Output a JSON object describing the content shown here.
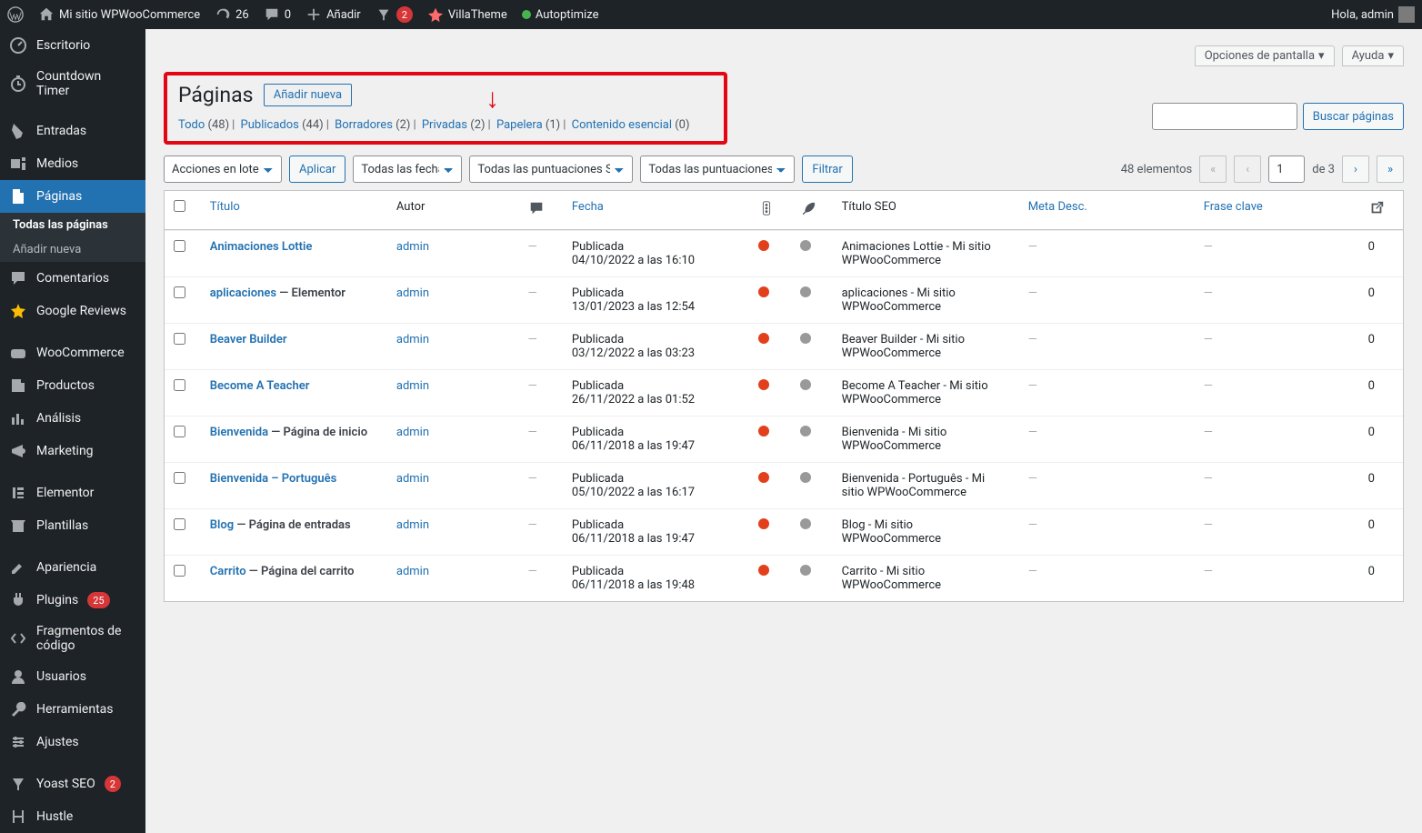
{
  "toolbar": {
    "site_name": "Mi sitio WPWooCommerce",
    "updates": "26",
    "comments": "0",
    "add_new": "Añadir",
    "yoast_count": "2",
    "villatheme": "VillaTheme",
    "autoptimize": "Autoptimize",
    "greeting": "Hola, admin"
  },
  "menu": {
    "dashboard": "Escritorio",
    "countdown": "Countdown Timer",
    "posts": "Entradas",
    "media": "Medios",
    "pages": "Páginas",
    "pages_sub_all": "Todas las páginas",
    "pages_sub_new": "Añadir nueva",
    "comments": "Comentarios",
    "greviews": "Google Reviews",
    "woocommerce": "WooCommerce",
    "products": "Productos",
    "analytics": "Análisis",
    "marketing": "Marketing",
    "elementor": "Elementor",
    "templates": "Plantillas",
    "appearance": "Apariencia",
    "plugins": "Plugins",
    "plugins_count": "25",
    "snippets": "Fragmentos de código",
    "users": "Usuarios",
    "tools": "Herramientas",
    "settings": "Ajustes",
    "yoast": "Yoast SEO",
    "yoast_count": "2",
    "hustle": "Hustle"
  },
  "screen": {
    "options": "Opciones de pantalla",
    "help": "Ayuda"
  },
  "heading": {
    "title": "Páginas",
    "addnew": "Añadir nueva"
  },
  "filters": {
    "all": "Todo",
    "all_count": "(48)",
    "published": "Publicados",
    "published_count": "(44)",
    "drafts": "Borradores",
    "drafts_count": "(2)",
    "private": "Privadas",
    "private_count": "(2)",
    "trash": "Papelera",
    "trash_count": "(1)",
    "cornerstone": "Contenido esencial",
    "cornerstone_count": "(0)"
  },
  "actions": {
    "bulk": "Acciones en lote",
    "apply": "Aplicar",
    "all_dates": "Todas las fechas",
    "seo_scores": "Todas las puntuaciones SEO",
    "read_scores": "Todas las puntuaciones de legibilidad",
    "filter": "Filtrar",
    "search": "Buscar páginas"
  },
  "pagination": {
    "items": "48 elementos",
    "current": "1",
    "total": "de 3"
  },
  "columns": {
    "title": "Título",
    "author": "Autor",
    "date": "Fecha",
    "seotitle": "Título SEO",
    "meta": "Meta Desc.",
    "focus": "Frase clave"
  },
  "rows": [
    {
      "title": "Animaciones Lottie",
      "state": "",
      "author": "admin",
      "status": "Publicada",
      "date": "04/10/2022 a las 16:10",
      "seo_title": "Animaciones Lottie - Mi sitio WPWooCommerce",
      "links": "0"
    },
    {
      "title": "aplicaciones",
      "state": " — Elementor",
      "author": "admin",
      "status": "Publicada",
      "date": "13/01/2023 a las 12:54",
      "seo_title": "aplicaciones - Mi sitio WPWooCommerce",
      "links": "0"
    },
    {
      "title": "Beaver Builder",
      "state": "",
      "author": "admin",
      "status": "Publicada",
      "date": "03/12/2022 a las 03:23",
      "seo_title": "Beaver Builder - Mi sitio WPWooCommerce",
      "links": "0"
    },
    {
      "title": "Become A Teacher",
      "state": "",
      "author": "admin",
      "status": "Publicada",
      "date": "26/11/2022 a las 01:52",
      "seo_title": "Become A Teacher - Mi sitio WPWooCommerce",
      "links": "0"
    },
    {
      "title": "Bienvenida",
      "state": " — Página de inicio",
      "author": "admin",
      "status": "Publicada",
      "date": "06/11/2018 a las 19:47",
      "seo_title": "Bienvenida - Mi sitio WPWooCommerce",
      "links": "0"
    },
    {
      "title": "Bienvenida – Português",
      "state": "",
      "author": "admin",
      "status": "Publicada",
      "date": "05/10/2022 a las 16:17",
      "seo_title": "Bienvenida - Português - Mi sitio WPWooCommerce",
      "links": "0"
    },
    {
      "title": "Blog",
      "state": " — Página de entradas",
      "author": "admin",
      "status": "Publicada",
      "date": "06/11/2018 a las 19:47",
      "seo_title": "Blog - Mi sitio WPWooCommerce",
      "links": "0"
    },
    {
      "title": "Carrito",
      "state": " — Página del carrito",
      "author": "admin",
      "status": "Publicada",
      "date": "06/11/2018 a las 19:48",
      "seo_title": "Carrito - Mi sitio WPWooCommerce",
      "links": "0"
    }
  ]
}
